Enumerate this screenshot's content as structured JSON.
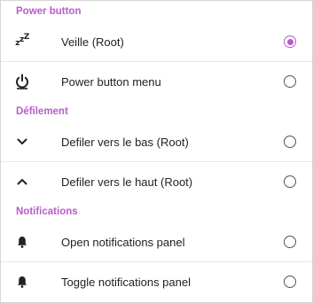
{
  "colors": {
    "accent": "#b85cc9",
    "text": "#222222",
    "divider": "#e6e6e6"
  },
  "sections": [
    {
      "title": "Power button",
      "items": [
        {
          "label": "Veille (Root)",
          "icon": "sleep-zzz-icon",
          "selected": true
        },
        {
          "label": "Power button menu",
          "icon": "power-icon",
          "selected": false
        }
      ]
    },
    {
      "title": "Défilement",
      "items": [
        {
          "label": "Defiler vers le bas (Root)",
          "icon": "chevron-down-icon",
          "selected": false
        },
        {
          "label": "Defiler vers le haut (Root)",
          "icon": "chevron-up-icon",
          "selected": false
        }
      ]
    },
    {
      "title": "Notifications",
      "items": [
        {
          "label": "Open notifications panel",
          "icon": "bell-icon",
          "selected": false
        },
        {
          "label": "Toggle notifications panel",
          "icon": "bell-icon",
          "selected": false
        }
      ]
    }
  ]
}
